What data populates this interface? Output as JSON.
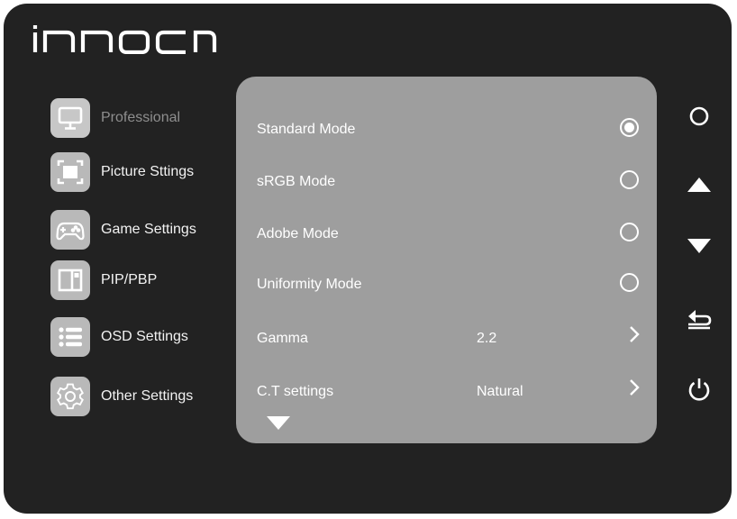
{
  "brand": {
    "name": "INNOCN"
  },
  "sidebar": {
    "items": [
      {
        "label": "Professional",
        "icon": "monitor-icon",
        "active": true
      },
      {
        "label": "Picture Sttings",
        "icon": "picture-frame-icon"
      },
      {
        "label": "Game Settings",
        "icon": "gamepad-icon"
      },
      {
        "label": "PIP/PBP",
        "icon": "pip-icon"
      },
      {
        "label": "OSD Settings",
        "icon": "list-icon"
      },
      {
        "label": "Other Settings",
        "icon": "gear-icon"
      }
    ]
  },
  "panel": {
    "rows": [
      {
        "label": "Standard Mode",
        "control": "radio",
        "selected": true
      },
      {
        "label": "sRGB Mode",
        "control": "radio",
        "selected": false
      },
      {
        "label": "Adobe Mode",
        "control": "radio",
        "selected": false
      },
      {
        "label": "Uniformity Mode",
        "control": "radio",
        "selected": false
      },
      {
        "label": "Gamma",
        "value": "2.2",
        "control": "submenu"
      },
      {
        "label": "C.T settings",
        "value": "Natural",
        "control": "submenu"
      }
    ],
    "more_indicator": "chevron-down-icon"
  },
  "buttons": [
    {
      "name": "ok-button",
      "icon": "circle-icon"
    },
    {
      "name": "up-button",
      "icon": "triangle-up-icon"
    },
    {
      "name": "down-button",
      "icon": "triangle-down-icon"
    },
    {
      "name": "back-button",
      "icon": "return-arrow-icon"
    },
    {
      "name": "power-button",
      "icon": "power-icon"
    }
  ],
  "colors": {
    "frame": "#222222",
    "panel": "#9e9e9e",
    "icon_tile": "#b9b9b9",
    "text": "#ffffff",
    "inactive_text": "#8e8e8e"
  }
}
